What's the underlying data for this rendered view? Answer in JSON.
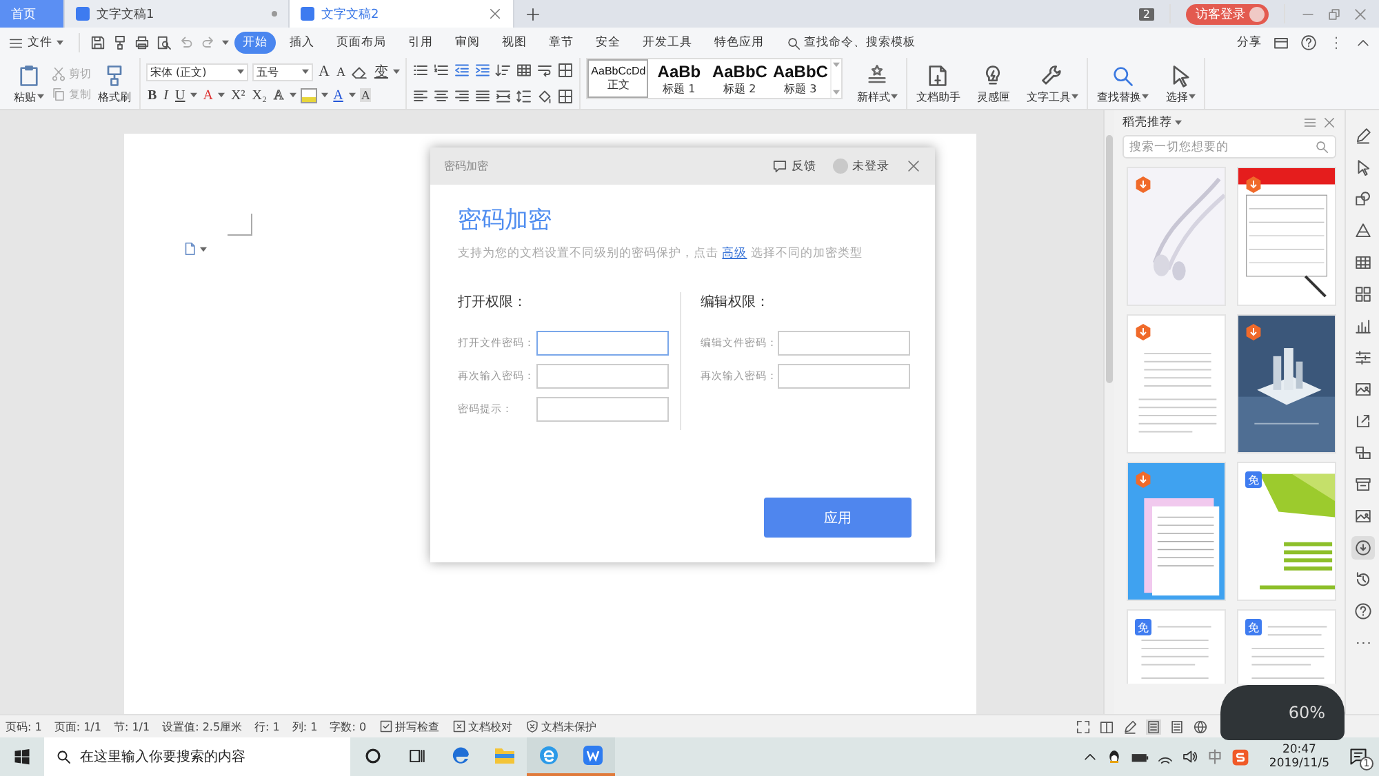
{
  "tabs": [
    {
      "label": "首页",
      "kind": "home",
      "selected": false
    },
    {
      "label": "文字文稿1",
      "kind": "doc",
      "selected": false
    },
    {
      "label": "文字文稿2",
      "kind": "doc",
      "selected": true
    }
  ],
  "title_bar": {
    "window_count": "2",
    "login": "访客登录"
  },
  "menu": {
    "file": "文件",
    "tabs": [
      {
        "label": "开始",
        "selected": true
      },
      {
        "label": "插入",
        "selected": false
      },
      {
        "label": "页面布局",
        "selected": false
      },
      {
        "label": "引用",
        "selected": false
      },
      {
        "label": "审阅",
        "selected": false
      },
      {
        "label": "视图",
        "selected": false
      },
      {
        "label": "章节",
        "selected": false
      },
      {
        "label": "安全",
        "selected": false
      },
      {
        "label": "开发工具",
        "selected": false
      },
      {
        "label": "特色应用",
        "selected": false
      }
    ],
    "search": "查找命令、搜索模板",
    "share": "分享"
  },
  "ribbon": {
    "paste": "粘贴",
    "cut": {
      "label": "剪切",
      "disabled": true
    },
    "copy": {
      "label": "复制",
      "disabled": true
    },
    "format_painter": "格式刷",
    "font": "宋体 (正文)",
    "size": "五号",
    "font_row": [
      {
        "text": "A",
        "kind": "grow"
      },
      {
        "text": "A",
        "kind": "shrink"
      },
      {
        "kind": "eraser"
      },
      {
        "text": "变",
        "kind": "menu"
      }
    ],
    "format_row": [
      {
        "text": "B",
        "kind": "bold"
      },
      {
        "text": "I",
        "kind": "italic"
      },
      {
        "text": "U",
        "kind": "underline"
      },
      {
        "text": "A",
        "kind": "strike"
      },
      {
        "text": "X²",
        "kind": "plain"
      },
      {
        "text": "X₂",
        "kind": "plain"
      },
      {
        "text": "A",
        "kind": "outline"
      },
      {
        "kind": "highlight"
      },
      {
        "text": "A",
        "kind": "color"
      },
      {
        "text": "A",
        "kind": "shade"
      }
    ],
    "styles": [
      {
        "preview": "AaBbCcDd",
        "name": "正文",
        "selected": true
      },
      {
        "preview": "AaBb",
        "name": "标题 1",
        "selected": false
      },
      {
        "preview": "AaBbC",
        "name": "标题 2",
        "selected": false
      },
      {
        "preview": "AaBbC",
        "name": "标题 3",
        "selected": false
      }
    ],
    "tools": [
      {
        "label": "新样式",
        "dropdown": true
      },
      {
        "label": "文档助手",
        "dropdown": false
      },
      {
        "label": "灵感匣",
        "dropdown": false
      },
      {
        "label": "文字工具",
        "dropdown": true
      },
      {
        "label": "查找替换",
        "dropdown": true
      },
      {
        "label": "选择",
        "dropdown": true
      }
    ]
  },
  "dialog": {
    "title": "密码加密",
    "feedback": "反馈",
    "account": "未登录",
    "heading": "密码加密",
    "description_before": "支持为您的文档设置不同级别的密码保护，点击",
    "link": "高级",
    "description_after": "选择不同的加密类型",
    "sections": [
      {
        "title": "打开权限：",
        "fields": [
          {
            "label": "打开文件密码：",
            "focused": true
          },
          {
            "label": "再次输入密码：",
            "focused": false
          },
          {
            "label": "密码提示：",
            "focused": false
          }
        ]
      },
      {
        "title": "编辑权限：",
        "fields": [
          {
            "label": "编辑文件密码：",
            "focused": false
          },
          {
            "label": "再次输入密码：",
            "focused": false
          }
        ]
      }
    ],
    "button": "应用"
  },
  "panel": {
    "title": "稻壳推荐",
    "search": "搜索一切您想要的",
    "templates": [
      {
        "kind": "premium"
      },
      {
        "kind": "premium"
      },
      {
        "kind": "premium"
      },
      {
        "kind": "premium"
      },
      {
        "kind": "premium"
      },
      {
        "kind": "free",
        "tag": "免"
      },
      {
        "kind": "free",
        "tag": "免"
      },
      {
        "kind": "free",
        "tag": "免"
      }
    ]
  },
  "status_bar": {
    "items": [
      {
        "text": "页码: 1",
        "kind": "plain"
      },
      {
        "text": "页面: 1/1",
        "kind": "plain"
      },
      {
        "text": "节: 1/1",
        "kind": "plain"
      },
      {
        "text": "设置值: 2.5厘米",
        "kind": "plain"
      },
      {
        "text": "行: 1",
        "kind": "plain"
      },
      {
        "text": "列: 1",
        "kind": "plain"
      },
      {
        "text": "字数: 0",
        "kind": "plain"
      },
      {
        "text": "拼写检查",
        "kind": "spell"
      },
      {
        "text": "文档校对",
        "kind": "proofread"
      },
      {
        "text": "文档未保护",
        "kind": "protect"
      }
    ]
  },
  "speed_widget": {
    "reading": "60%"
  },
  "taskbar": {
    "search": "在这里输入你要搜索的内容",
    "apps": [
      {
        "kind": "edge",
        "running": false
      },
      {
        "kind": "explorer",
        "running": false
      },
      {
        "kind": "ie",
        "running": true
      },
      {
        "kind": "wps",
        "running": true
      }
    ],
    "time": "20:47",
    "date": "2019/11/5",
    "notifications": "1"
  }
}
